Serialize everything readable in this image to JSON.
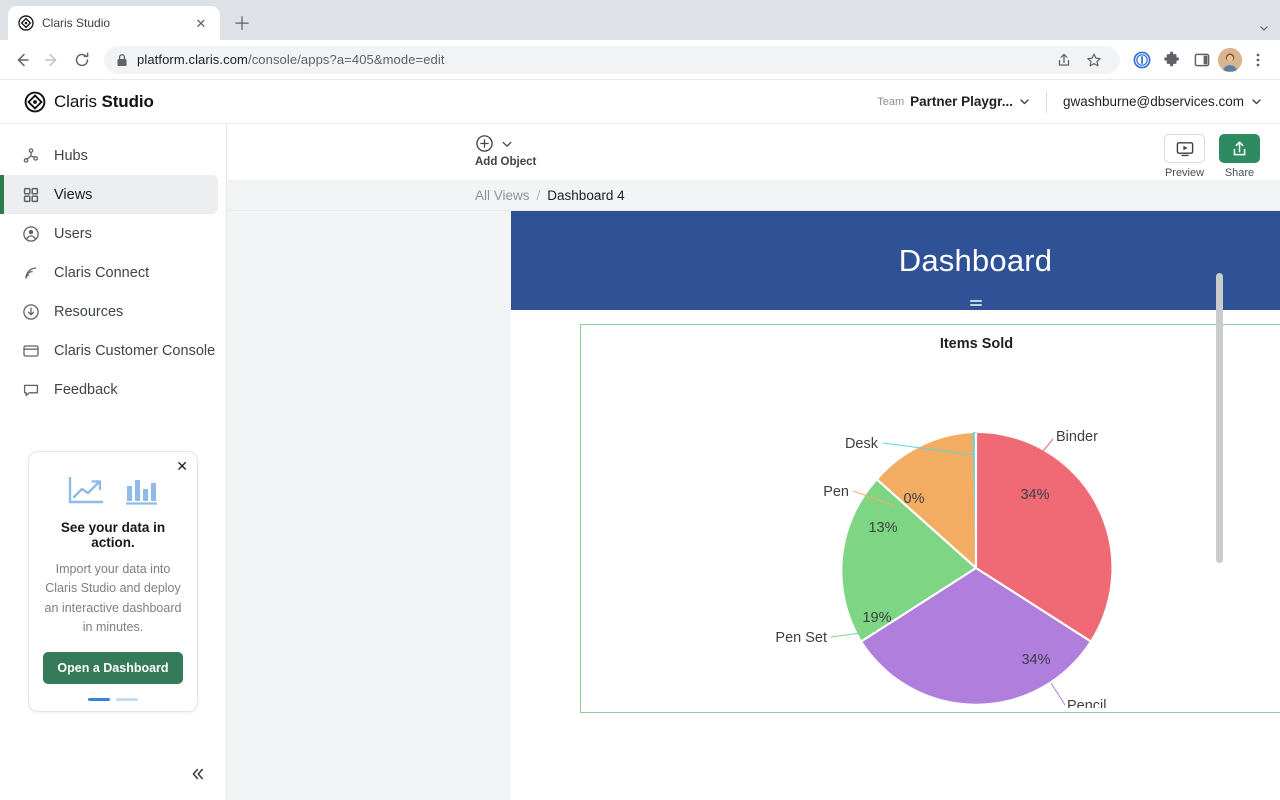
{
  "browser": {
    "tab": {
      "title": "Claris Studio",
      "favicon_icon": "claris-logo-icon",
      "close_icon": "close-icon"
    },
    "new_tab_icon": "plus-icon",
    "tabstrip_menu_icon": "chevron-down-icon",
    "nav": {
      "back_icon": "arrow-left-icon",
      "forward_icon": "arrow-right-icon",
      "reload_icon": "reload-icon"
    },
    "omnibox": {
      "lock_icon": "lock-icon",
      "url_bold": "platform.claris.com",
      "url_dim": "/console/apps?a=405&mode=edit",
      "share_icon": "share-icon",
      "bookmark_icon": "star-icon"
    },
    "extensions": {
      "password_manager_icon": "password-manager-icon",
      "puzzle_icon": "extensions-puzzle-icon",
      "side_panel_icon": "side-panel-icon",
      "avatar_icon": "user-avatar",
      "menu_icon": "three-dots-vertical-icon"
    }
  },
  "appbar": {
    "brand_light": "Claris",
    "brand_bold": "Studio",
    "brand_icon": "claris-diamond-logo-icon",
    "team_label": "Team",
    "team_name": "Partner Playgr...",
    "team_chevron_icon": "chevron-down-icon",
    "user_email": "gwashburne@dbservices.com",
    "user_chevron_icon": "chevron-down-icon"
  },
  "sidebar": {
    "items": [
      {
        "label": "Hubs",
        "icon": "hubs-share-icon",
        "active": false
      },
      {
        "label": "Views",
        "icon": "views-grid-icon",
        "active": true
      },
      {
        "label": "Users",
        "icon": "user-circle-icon",
        "active": false
      },
      {
        "label": "Claris Connect",
        "icon": "rss-signal-icon",
        "active": false
      },
      {
        "label": "Resources",
        "icon": "download-circle-icon",
        "active": false
      },
      {
        "label": "Claris Customer Console",
        "icon": "window-icon",
        "active": false
      },
      {
        "label": "Feedback",
        "icon": "chat-bubble-icon",
        "active": false
      }
    ],
    "promo": {
      "close_icon": "close-icon",
      "icon_line_chart": "line-chart-arrow-icon",
      "icon_bar_chart": "bar-chart-icon",
      "title": "See your data in action.",
      "body": "Import your data into Claris Studio and deploy an interactive dashboard in minutes.",
      "button_label": "Open a Dashboard",
      "dots": [
        true,
        false
      ]
    },
    "collapse_icon": "chevron-double-left-icon"
  },
  "toolbar": {
    "add_object_label": "Add Object",
    "add_object_icon": "plus-circle-icon",
    "add_object_chevron_icon": "chevron-down-icon",
    "preview_label": "Preview",
    "preview_icon": "monitor-play-icon",
    "share_label": "Share",
    "share_icon": "upload-share-icon"
  },
  "breadcrumb": {
    "root": "All Views",
    "separator": "/",
    "current": "Dashboard 4"
  },
  "canvas": {
    "banner_title": "Dashboard",
    "banner_color": "#2f5196",
    "resize_handle_icon": "resize-handle-icon",
    "card": {
      "settings_icon": "gear-icon",
      "more_icon": "more-options-circle-icon",
      "selected_border_color": "#8fcfa0"
    }
  },
  "chart_data": {
    "type": "pie",
    "title": "Items Sold",
    "categories": [
      "Binder",
      "Pencil",
      "Pen Set",
      "Pen",
      "Desk"
    ],
    "values": [
      34,
      34,
      19,
      13,
      0
    ],
    "value_labels": [
      "34%",
      "34%",
      "19%",
      "13%",
      "0%"
    ],
    "colors": [
      "#ef6a75",
      "#b07edd",
      "#7ed584",
      "#f2ad63",
      "#5fd6d6"
    ],
    "legend": "none",
    "labels_position": "outside-with-leader-lines",
    "units": "percent"
  }
}
